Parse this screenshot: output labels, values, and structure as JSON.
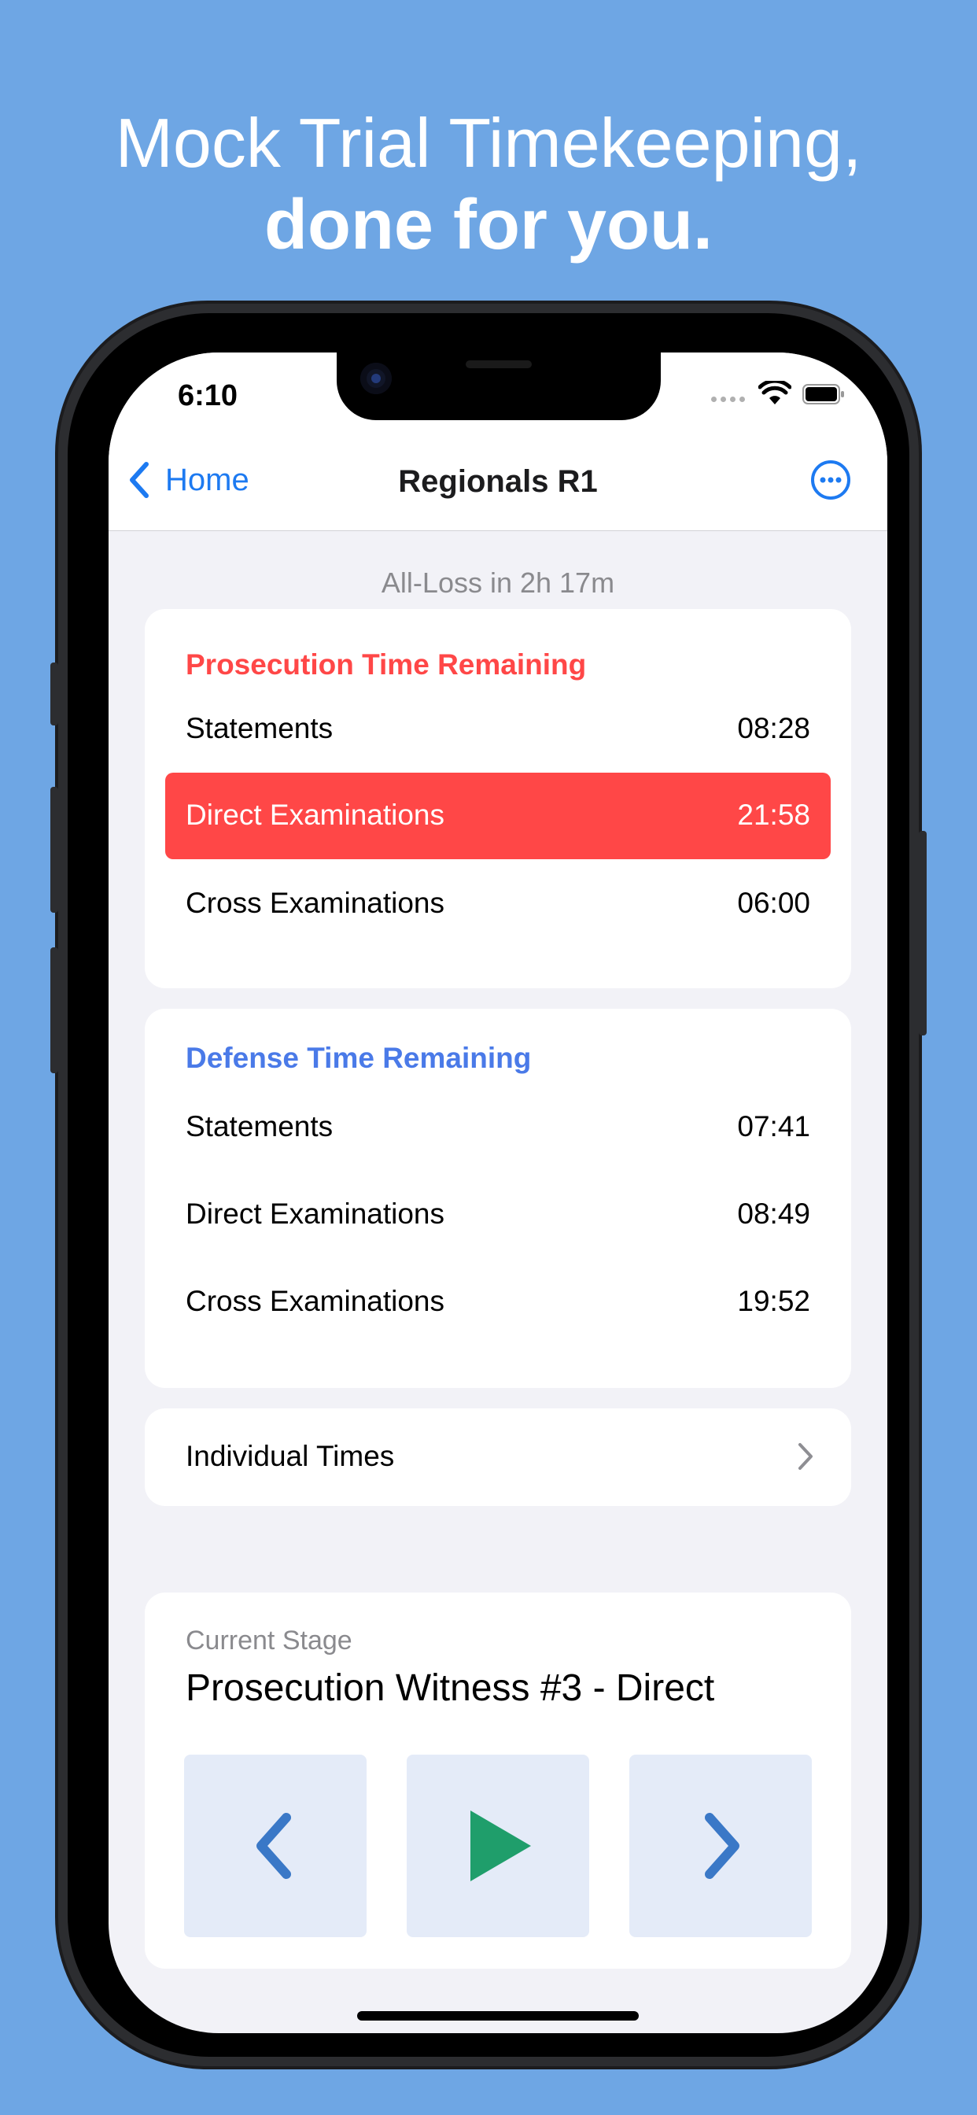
{
  "headline": {
    "line1": "Mock Trial Timekeeping,",
    "line2": "done for you."
  },
  "status_bar": {
    "time": "6:10"
  },
  "nav": {
    "back_label": "Home",
    "title": "Regionals R1",
    "more_icon": "ellipsis-circle-icon"
  },
  "subtitle": "All-Loss in 2h 17m",
  "prosecution": {
    "title": "Prosecution Time Remaining",
    "color": "#ff4747",
    "rows": [
      {
        "label": "Statements",
        "value": "08:28"
      },
      {
        "label": "Direct Examinations",
        "value": "21:58",
        "active": true
      },
      {
        "label": "Cross Examinations",
        "value": "06:00"
      }
    ]
  },
  "defense": {
    "title": "Defense Time Remaining",
    "color": "#4a7ae8",
    "rows": [
      {
        "label": "Statements",
        "value": "07:41"
      },
      {
        "label": "Direct Examinations",
        "value": "08:49"
      },
      {
        "label": "Cross Examinations",
        "value": "19:52"
      }
    ]
  },
  "individual_times": {
    "label": "Individual Times"
  },
  "stage": {
    "caption": "Current Stage",
    "name": "Prosecution Witness #3 - Direct",
    "controls": [
      "chevron-left-icon",
      "play-icon",
      "chevron-right-icon"
    ]
  }
}
